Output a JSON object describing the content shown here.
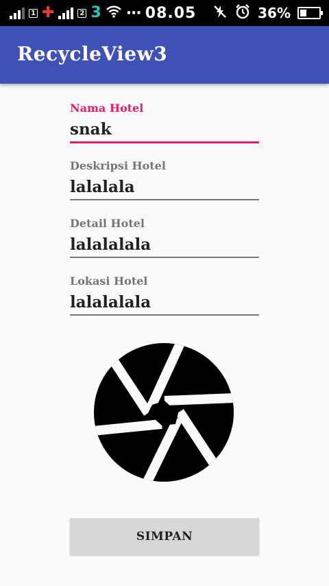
{
  "status_bar": {
    "sim1_label": "1",
    "sim2_label": "2",
    "carrier2_icon": "3",
    "overflow": "···",
    "time": "08.05",
    "battery_percent": "36%",
    "battery_level": 0.36
  },
  "app_bar": {
    "title": "RecycleView3",
    "color": "#3f51b5"
  },
  "form": {
    "fields": [
      {
        "label": "Nama Hotel",
        "value": "snak",
        "focused": true
      },
      {
        "label": "Deskripsi Hotel",
        "value": "lalalala",
        "focused": false
      },
      {
        "label": "Detail Hotel",
        "value": "lalalalala",
        "focused": false
      },
      {
        "label": "Lokasi Hotel",
        "value": "lalalalala",
        "focused": false
      }
    ],
    "accent_color": "#e91e63",
    "image_icon": "camera-shutter-icon",
    "save_label": "SIMPAN"
  }
}
